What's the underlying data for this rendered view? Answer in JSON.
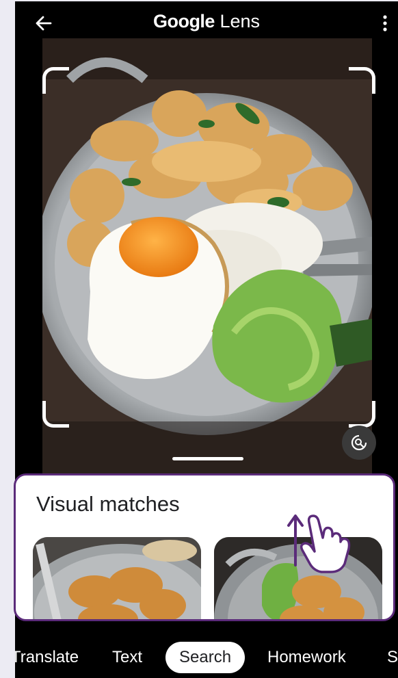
{
  "app": {
    "title_brand": "Google",
    "title_product": "Lens"
  },
  "icons": {
    "back": "arrow-left-icon",
    "more": "more-vert-icon",
    "lens_search": "image-search-icon",
    "gesture": "hand-swipe-up-icon"
  },
  "results": {
    "heading": "Visual matches"
  },
  "tabs": [
    {
      "label": "Translate",
      "active": false
    },
    {
      "label": "Text",
      "active": false
    },
    {
      "label": "Search",
      "active": true
    },
    {
      "label": "Homework",
      "active": false
    },
    {
      "label": "Shopping",
      "active": false
    }
  ],
  "colors": {
    "highlight_border": "#5b2b7a",
    "active_tab_bg": "#ffffff"
  }
}
